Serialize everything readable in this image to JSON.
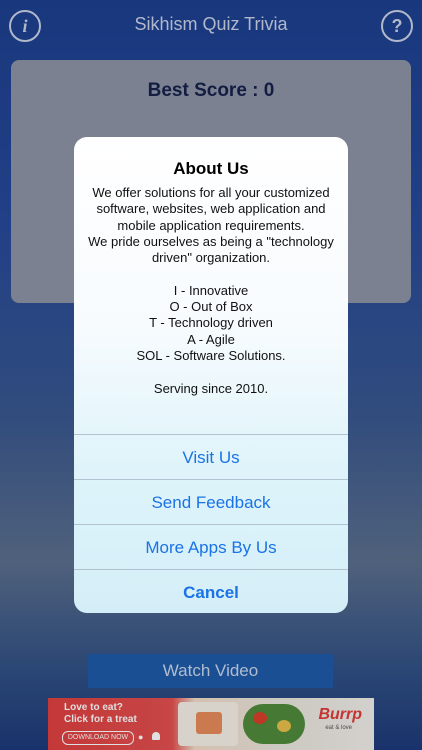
{
  "header": {
    "title": "Sikhism Quiz Trivia",
    "info_icon_glyph": "i",
    "help_icon_glyph": "?"
  },
  "card": {
    "best_score": "Best Score : 0"
  },
  "dialog": {
    "title": "About Us",
    "message": "We offer solutions for all your customized software, websites, web application and mobile application requirements.\nWe pride ourselves as being a \"technology driven\" organization.\n\nI - Innovative\nO - Out of Box\nT - Technology driven\nA - Agile\nSOL - Software Solutions.\n\nServing since 2010.",
    "actions": [
      "Visit Us",
      "Send Feedback",
      "More Apps By Us",
      "Cancel"
    ]
  },
  "watch_video": "Watch Video",
  "ad": {
    "line1": "Love to eat?",
    "line2": "Click for a treat",
    "download": "DOWNLOAD NOW",
    "brand": "Burrp",
    "tagline": "eat & love"
  },
  "colors": {
    "accent": "#1a73e6",
    "header_text": "#c9d2e6",
    "watch_button": "#1e5aa8"
  }
}
